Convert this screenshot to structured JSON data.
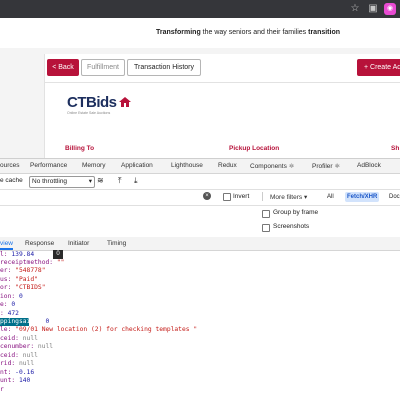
{
  "browser": {
    "star_icon": "star-icon",
    "ext_icon": "extension-icon"
  },
  "header": {
    "tagline_bold1": "Transforming",
    "tagline_mid": " the way seniors and their families ",
    "tagline_bold2": "transition"
  },
  "toolbar": {
    "back": "< Back",
    "fulfillment": "Fulfillment",
    "history": "Transaction History",
    "create": "+ Create Ad"
  },
  "logo": {
    "text": "CTBids",
    "tagline": "Online Estate Sale Auctions"
  },
  "sections": {
    "billing": "Billing To",
    "pickup": "Pickup Location",
    "ship": "Sh"
  },
  "devtools": {
    "tabs": [
      "ources",
      "Performance",
      "Memory",
      "Application",
      "Lighthouse",
      "Redux",
      "Components ⚛",
      "Profiler ⚛",
      "AdBlock"
    ],
    "cache_label": "e cache",
    "throttle": "No throttling",
    "invert": "Invert",
    "more_filters": "More filters",
    "all": "All",
    "fetch": "Fetch/XHR",
    "doc": "Doc",
    "group_by_frame": "Group by frame",
    "screenshots": "Screenshots",
    "detail_tabs": [
      "view",
      "Response",
      "Initiator",
      "Timing"
    ],
    "tooltip": "0"
  },
  "payload": [
    {
      "key": "l: ",
      "val": "139.84",
      "cls": "v"
    },
    {
      "key": "receiptmethod: ",
      "val": "\"\"",
      "cls": "s"
    },
    {
      "key": "er: ",
      "val": "\"548778\"",
      "cls": "s"
    },
    {
      "key": "us: ",
      "val": "\"Paid\"",
      "cls": "s"
    },
    {
      "key": "or: ",
      "val": "\"CTBIDS\"",
      "cls": "s"
    },
    {
      "key": "ion: ",
      "val": "0",
      "cls": "v"
    },
    {
      "key": "e: ",
      "val": "0",
      "cls": "v"
    },
    {
      "key": ": ",
      "val": "472",
      "cls": "v"
    },
    {
      "key": "ppingsaint: ",
      "val": "0",
      "cls": "v"
    },
    {
      "key": "le: ",
      "val": "\"09/01 New location (2) for checking templates \"",
      "cls": "s"
    },
    {
      "key": "ceid: ",
      "val": "null",
      "cls": "n"
    },
    {
      "key": "cenumber: ",
      "val": "null",
      "cls": "n"
    },
    {
      "key": "ceid: ",
      "val": "null",
      "cls": "n"
    },
    {
      "key": "rid: ",
      "val": "null",
      "cls": "n"
    },
    {
      "key": "nt: ",
      "val": "-0.16",
      "cls": "v"
    },
    {
      "key": "unt: ",
      "val": "140",
      "cls": "v"
    },
    {
      "key": "r",
      "val": "",
      "cls": "v"
    }
  ]
}
